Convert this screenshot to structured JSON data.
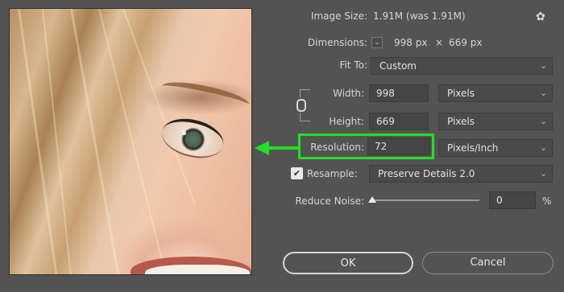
{
  "image_size": {
    "label": "Image Size:",
    "value": "1.91M (was 1.91M)"
  },
  "dimensions": {
    "label": "Dimensions:",
    "width": "998 px",
    "separator": "×",
    "height": "669 px"
  },
  "fit_to": {
    "label": "Fit To:",
    "value": "Custom"
  },
  "width": {
    "label": "Width:",
    "value": "998",
    "unit": "Pixels"
  },
  "height": {
    "label": "Height:",
    "value": "669",
    "unit": "Pixels"
  },
  "resolution": {
    "label": "Resolution:",
    "value": "72",
    "unit": "Pixels/Inch"
  },
  "resample": {
    "label": "Resample:",
    "checked": true,
    "method": "Preserve Details 2.0"
  },
  "reduce_noise": {
    "label": "Reduce Noise:",
    "value": "0",
    "unit": "%",
    "level_fraction": 0.0
  },
  "buttons": {
    "ok": "OK",
    "cancel": "Cancel"
  },
  "icons": {
    "settings": "gear-icon",
    "dimensions_toggle": "chevron-down-icon",
    "constrain": "chain-link-icon",
    "dropdown": "chevron-down-icon",
    "arrow": "arrow-left-icon"
  },
  "colors": {
    "highlight": "#22e022",
    "panel_background": "#535353"
  }
}
